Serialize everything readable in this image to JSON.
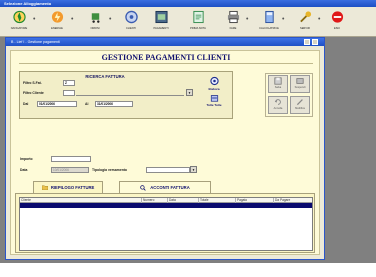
{
  "window": {
    "title": "Selezione Alloggiamento"
  },
  "toolbar": {
    "buttons": [
      {
        "label": "NAVIGATORE",
        "icon": "compass-icon",
        "color": "#1e8a2e"
      },
      {
        "label": "ENERGIE",
        "icon": "energy-icon",
        "color": "#d4701c"
      },
      {
        "label": "ORDINI",
        "icon": "cart-icon",
        "color": "#2c6b2f"
      },
      {
        "label": "CLIENTI",
        "icon": "disc-icon",
        "color": "#3a5bb0"
      },
      {
        "label": "PAGAMENTI",
        "icon": "money-icon",
        "color": "#1a4f7a"
      },
      {
        "label": "PRIMA NOTA",
        "icon": "notes-icon",
        "color": "#2f8a4a"
      },
      {
        "label": "FARE",
        "icon": "printer-icon",
        "color": "#3d3d3d"
      },
      {
        "label": "CALCOLATRICE",
        "icon": "calculator-icon",
        "color": "#4a7ad2"
      },
      {
        "label": "SERVIZI",
        "icon": "tools-icon",
        "color": "#d8a21a"
      },
      {
        "label": "ESCI",
        "icon": "exit-icon",
        "color": "#d01010"
      }
    ]
  },
  "child": {
    "title": "B - Lief  I - Gestione pagamenti"
  },
  "page": {
    "heading": "GESTIONE PAGAMENTI CLIENTI"
  },
  "search": {
    "title": "RICERCA FATTURA",
    "serie_label": "Filtro S.Fat.",
    "serie_value": "Z",
    "cliente_label": "Filtro Cliente",
    "dal_label": "Dal",
    "dal_value": "01/01/2006",
    "al_label": "Al",
    "al_value": "31/01/2006",
    "elabora_label": "Elabora",
    "tutte_label": "Tutte Tutte"
  },
  "pay": {
    "importo_label": "Importo",
    "data_label": "Data",
    "data_value": "10/01/2006",
    "tipologia_label": "Tipologia versamento"
  },
  "side_buttons": [
    {
      "label": "Salva",
      "icon": "save-icon"
    },
    {
      "label": "Sospendi",
      "icon": "suspend-icon"
    },
    {
      "label": "Annulla",
      "icon": "undo-icon"
    },
    {
      "label": "Modifica",
      "icon": "edit-icon"
    }
  ],
  "tabs": [
    {
      "label": "RIEPILOGO FATTURE",
      "icon": "folder-icon"
    },
    {
      "label": "ACCONTI FATTURA",
      "icon": "search-icon"
    }
  ],
  "grid": {
    "columns": [
      "Cliente",
      "Numero",
      "Data",
      "Totale",
      "Pagato",
      "Da Pagare"
    ],
    "selected_color": "#0a0a6e"
  }
}
